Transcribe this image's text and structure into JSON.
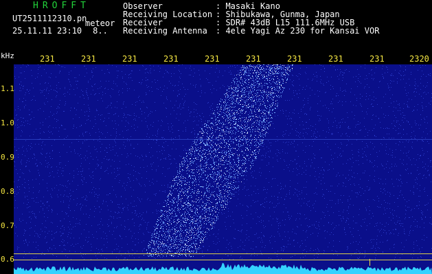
{
  "header": {
    "app_title": "HROFFT",
    "file_name": "UT2511112310.pn",
    "mode": "meteor",
    "timestamp": "25.11.11 23:10",
    "counter": "8.."
  },
  "info": [
    {
      "label": "Observer",
      "value": ": Masaki Kano"
    },
    {
      "label": "Receiving Location",
      "value": ": Shibukawa, Gunma, Japan"
    },
    {
      "label": "Receiver",
      "value": ": SDR# 43dB L15 111.6MHz USB"
    },
    {
      "label": "Receiving Antenna",
      "value": ": 4ele Yagi Az 230 for Kansai VOR"
    }
  ],
  "ruler": {
    "unit": "kHz",
    "ticks": [
      "231",
      "231",
      "231",
      "231",
      "231",
      "231",
      "231",
      "231",
      "231",
      "2320"
    ]
  },
  "yaxis": {
    "labels": [
      "1.1",
      "1.0",
      "0.9",
      "0.8",
      "0.7",
      "0.6"
    ]
  },
  "colors": {
    "background": "#000000",
    "plot_background": "#0a0f8a",
    "title_green": "#22d43a",
    "axis_yellow": "#f5e642",
    "echo_cyan": "#6fa8ff",
    "noise_floor": "#34d2ff"
  }
}
